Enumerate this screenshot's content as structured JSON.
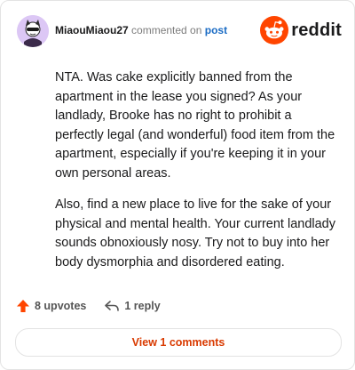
{
  "author": {
    "username": "MiaouMiaou27"
  },
  "meta": {
    "commented_on": "commented on",
    "post_link": "post"
  },
  "brand": {
    "name": "reddit",
    "color": "#FF4500",
    "icon": "reddit-snoo-icon"
  },
  "comment": {
    "paragraphs": [
      "NTA. Was cake explicitly banned from the apartment in the lease you signed? As your landlady, Brooke has no right to prohibit a perfectly legal (and wonderful) food item from the apartment, especially if you're keeping it in your own personal areas.",
      "Also, find a new place to live for the sake of your physical and mental health. Your current landlady sounds obnoxiously nosy. Try not to buy into her body dysmorphia and disordered eating."
    ]
  },
  "actions": {
    "upvotes_label": "8 upvotes",
    "upvote_icon": "upvote-arrow-icon",
    "upvote_color": "#FF4500",
    "reply_label": "1 reply",
    "reply_icon": "reply-arrow-icon"
  },
  "view_comments": {
    "label": "View 1 comments",
    "color": "#D93A00"
  }
}
